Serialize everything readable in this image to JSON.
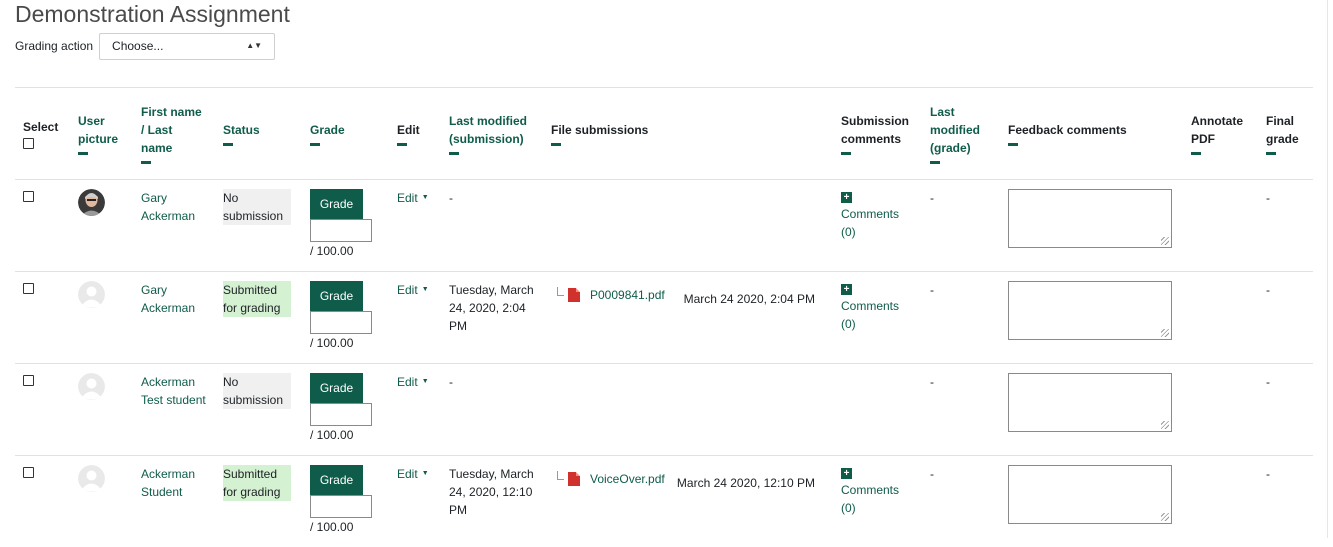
{
  "page": {
    "title": "Demonstration Assignment"
  },
  "grading_action": {
    "label": "Grading action",
    "selected": "Choose..."
  },
  "columns": {
    "select": "Select",
    "user_picture": "User picture",
    "name": "First name / Last name",
    "status": "Status",
    "grade": "Grade",
    "edit": "Edit",
    "last_modified_submission": "Last modified (submission)",
    "file_submissions": "File submissions",
    "submission_comments": "Submission comments",
    "last_modified_grade": "Last modified (grade)",
    "feedback_comments": "Feedback comments",
    "annotate_pdf": "Annotate PDF",
    "final_grade": "Final grade"
  },
  "rows": [
    {
      "name": "Gary Ackerman",
      "status": "No submission",
      "status_kind": "none",
      "grade_button": "Grade",
      "grade_max": "/ 100.00",
      "edit": "Edit",
      "last_modified": "-",
      "file": "",
      "file_date": "",
      "comments": "Comments (0)",
      "last_modified_grade": "-",
      "final_grade": "-",
      "avatar": "photo"
    },
    {
      "name": "Gary Ackerman",
      "status": "Submitted for grading",
      "status_kind": "submitted",
      "grade_button": "Grade",
      "grade_max": "/ 100.00",
      "edit": "Edit",
      "last_modified": "Tuesday, March 24, 2020, 2:04 PM",
      "file": "P0009841.pdf",
      "file_date": "March 24 2020, 2:04 PM",
      "comments": "Comments (0)",
      "last_modified_grade": "-",
      "final_grade": "-",
      "avatar": "default"
    },
    {
      "name": "Ackerman Test student",
      "status": "No submission",
      "status_kind": "none",
      "grade_button": "Grade",
      "grade_max": "/ 100.00",
      "edit": "Edit",
      "last_modified": "-",
      "file": "",
      "file_date": "",
      "comments": "",
      "last_modified_grade": "-",
      "final_grade": "-",
      "avatar": "default"
    },
    {
      "name": "Ackerman Student",
      "status": "Submitted for grading",
      "status_kind": "submitted",
      "grade_button": "Grade",
      "grade_max": "/ 100.00",
      "edit": "Edit",
      "last_modified": "Tuesday, March 24, 2020, 12:10 PM",
      "file": "VoiceOver.pdf",
      "file_date": "March 24 2020, 12:10 PM",
      "comments": "Comments (0)",
      "last_modified_grade": "-",
      "final_grade": "-",
      "avatar": "default"
    }
  ],
  "colors": {
    "accent": "#0f5c4a",
    "submitted_bg": "#d4f1d2",
    "no_submission_bg": "#f0f0f0",
    "pdf_red": "#d0312d"
  }
}
